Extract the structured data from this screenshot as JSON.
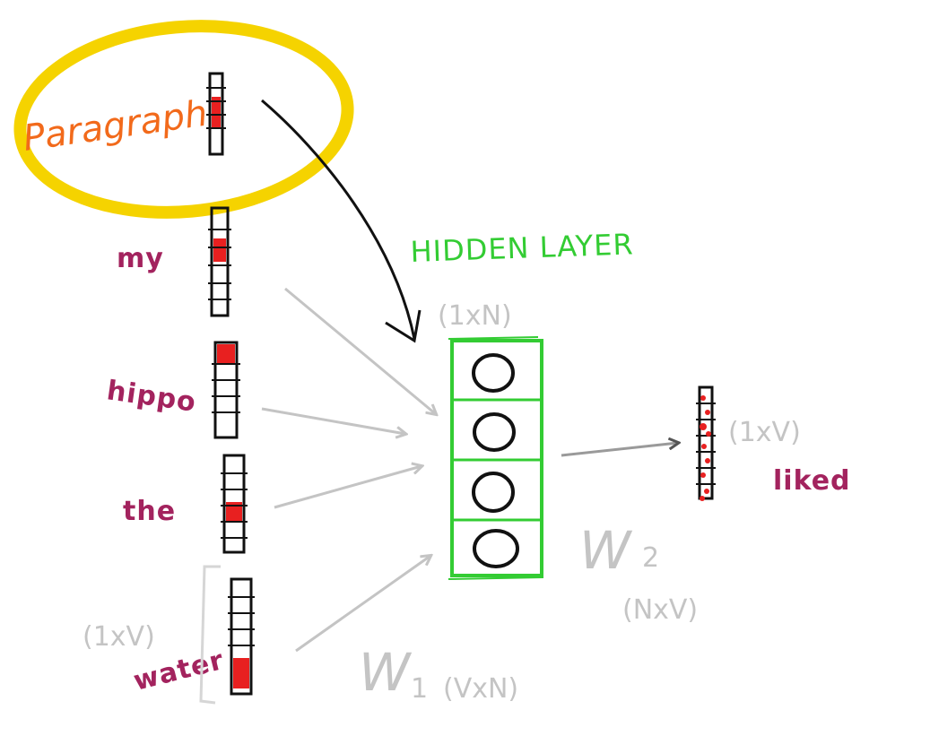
{
  "context_word": "Paragraph",
  "input_words": [
    "my",
    "hippo",
    "the",
    "water"
  ],
  "hidden_layer": {
    "title": "HIDDEN LAYER",
    "shape": "(1xN)",
    "nodes": [
      "O",
      "O",
      "O",
      "O"
    ]
  },
  "input_shape": "(1xV)",
  "w1_label": "W",
  "w1_sub": "1",
  "w1_shape": "(VxN)",
  "w2_label": "W",
  "w2_sub": "2",
  "w2_shape": "(NxV)",
  "output": {
    "word": "liked",
    "shape": "(1xV)"
  },
  "colors": {
    "highlight": "#f5d300",
    "paragraph": "#f26a1b",
    "words": "#a3235e",
    "hidden": "#33cc33",
    "arrows": "#c4c4c4",
    "active_cell": "#e82020"
  }
}
